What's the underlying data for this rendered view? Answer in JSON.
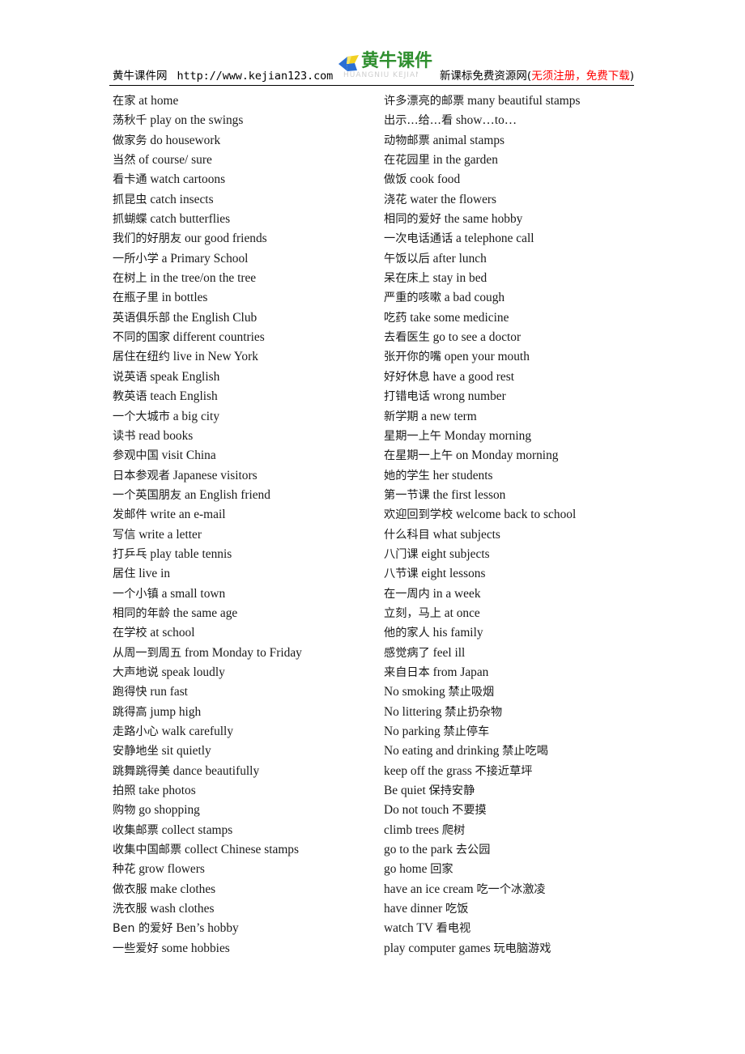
{
  "header": {
    "site_name": "黄牛课件网",
    "site_url": "http://www.kejian123.com",
    "logo_text": "黄牛课件",
    "logo_shadow_text": "HUANGNIU KEJIAN",
    "tagline_black_prefix": "新课标免费资源网(",
    "tagline_red": "无须注册，免费下载",
    "tagline_black_suffix": ")",
    "logo_green": "#2f8f2f",
    "accent_red": "#ff0000"
  },
  "columns": {
    "left": [
      {
        "cn": "在家",
        "en": "at home"
      },
      {
        "cn": "荡秋千",
        "en": " play on the swings"
      },
      {
        "cn": "做家务",
        "en": " do housework"
      },
      {
        "cn": "当然",
        "en": " of course/ sure"
      },
      {
        "cn": "看卡通",
        "en": "watch cartoons"
      },
      {
        "cn": "抓昆虫",
        "en": " catch insects"
      },
      {
        "cn": "抓蝴蝶",
        "en": " catch butterflies"
      },
      {
        "cn": "我们的好朋友",
        "en": "our good friends"
      },
      {
        "cn": "一所小学",
        "en": " a Primary School"
      },
      {
        "cn": "在树上",
        "en": " in the tree/on the tree"
      },
      {
        "cn": "在瓶子里",
        "en": "in bottles"
      },
      {
        "cn": "英语俱乐部",
        "en": "the English Club"
      },
      {
        "cn": "不同的国家",
        "en": "different countries"
      },
      {
        "cn": "居住在纽约",
        "en": " live in New York"
      },
      {
        "cn": "说英语",
        "en": " speak English"
      },
      {
        "cn": "教英语",
        "en": " teach English"
      },
      {
        "cn": "一个大城市",
        "en": " a big city"
      },
      {
        "cn": "读书",
        "en": " read books"
      },
      {
        "cn": "参观中国",
        "en": " visit China"
      },
      {
        "cn": "日本参观者",
        "en": "Japanese visitors"
      },
      {
        "cn": "一个英国朋友",
        "en": "an English friend"
      },
      {
        "cn": "发邮件",
        "en": " write an e-mail"
      },
      {
        "cn": "写信",
        "en": "write a letter"
      },
      {
        "cn": "打乒乓",
        "en": "play table tennis"
      },
      {
        "cn": "居住",
        "en": "live in"
      },
      {
        "cn": "一个小镇",
        "en": " a small town"
      },
      {
        "cn": "相同的年龄",
        "en": " the same age"
      },
      {
        "cn": "在学校",
        "en": " at school"
      },
      {
        "cn": "从周一到周五",
        "en": " from Monday to Friday"
      },
      {
        "cn": "大声地说",
        "en": " speak loudly"
      },
      {
        "cn": "跑得快",
        "en": " run fast"
      },
      {
        "cn": "跳得高",
        "en": " jump high"
      },
      {
        "cn": "走路小心",
        "en": "walk carefully"
      },
      {
        "cn": "安静地坐",
        "en": "sit quietly"
      },
      {
        "cn": "跳舞跳得美",
        "en": "dance beautifully"
      },
      {
        "cn": "拍照",
        "en": " take photos"
      },
      {
        "cn": "购物",
        "en": " go shopping"
      },
      {
        "cn": "收集邮票",
        "en": " collect stamps"
      },
      {
        "cn": "收集中国邮票",
        "en": "collect Chinese stamps"
      },
      {
        "cn": "种花",
        "en": " grow flowers"
      },
      {
        "cn": "做衣服",
        "en": "make clothes"
      },
      {
        "cn": "洗衣服",
        "en": "wash clothes"
      },
      {
        "cn": "Ben 的爱好",
        "en": " Ben’s hobby"
      },
      {
        "cn": "一些爱好",
        "en": " some hobbies"
      }
    ],
    "right": [
      {
        "cn": "许多漂亮的邮票",
        "en": "many beautiful stamps"
      },
      {
        "cn": "出示…给…看",
        "en": "show…to…"
      },
      {
        "cn": "动物邮票",
        "en": " animal stamps"
      },
      {
        "cn": "在花园里",
        "en": " in the  garden"
      },
      {
        "cn": "做饭",
        "en": " cook food"
      },
      {
        "cn": "浇花",
        "en": " water the flowers"
      },
      {
        "cn": "相同的爱好",
        "en": " the same hobby"
      },
      {
        "cn": "一次电话通话",
        "en": "a telephone call"
      },
      {
        "cn": "午饭以后",
        "en": " after lunch"
      },
      {
        "cn": "呆在床上",
        "en": "stay in bed"
      },
      {
        "cn": "严重的咳嗽",
        "en": "a bad cough"
      },
      {
        "cn": "吃药",
        "en": "take some medicine"
      },
      {
        "cn": "去看医生",
        "en": "go to see a doctor"
      },
      {
        "cn": "张开你的嘴",
        "en": "open your mouth"
      },
      {
        "cn": "好好休息",
        "en": "have a good rest"
      },
      {
        "cn": "打错电话",
        "en": " wrong number"
      },
      {
        "cn": "新学期",
        "en": " a new term"
      },
      {
        "cn": "星期一上午",
        "en": "Monday morning"
      },
      {
        "cn": "在星期一上午",
        "en": "on Monday morning"
      },
      {
        "cn": "她的学生",
        "en": " her students"
      },
      {
        "cn": "第一节课",
        "en": "the first lesson"
      },
      {
        "cn": "欢迎回到学校",
        "en": " welcome back to school"
      },
      {
        "cn": "什么科目",
        "en": "what subjects"
      },
      {
        "cn": "八门课",
        "en": "eight subjects"
      },
      {
        "cn": "八节课",
        "en": "eight lessons"
      },
      {
        "cn": "在一周内",
        "en": "in a week"
      },
      {
        "cn": "立刻，马上",
        "en": "at once"
      },
      {
        "cn": "他的家人",
        "en": "his family"
      },
      {
        "cn": "感觉病了",
        "en": "feel ill"
      },
      {
        "cn": "来自日本",
        "en": "from Japan"
      },
      {
        "en": "No smoking",
        "cn": " 禁止吸烟",
        "order": "en-first"
      },
      {
        "en": "No littering",
        "cn": "禁止扔杂物",
        "order": "en-first"
      },
      {
        "en": "No parking",
        "cn": "禁止停车",
        "order": "en-first"
      },
      {
        "en": "No eating and drinking",
        "cn": " 禁止吃喝",
        "order": "en-first"
      },
      {
        "en": "keep off the grass",
        "cn": "不接近草坪",
        "order": "en-first"
      },
      {
        "en": "Be quiet",
        "cn": "保持安静",
        "order": "en-first"
      },
      {
        "en": "Do not touch",
        "cn": "不要摸",
        "order": "en-first"
      },
      {
        "en": "climb trees",
        "cn": "爬树",
        "order": "en-first"
      },
      {
        "en": "go to the park",
        "cn": "去公园",
        "order": "en-first"
      },
      {
        "en": "go home",
        "cn": "回家",
        "order": "en-first"
      },
      {
        "en": "have an ice cream",
        "cn": "吃一个冰激凌",
        "order": "en-first"
      },
      {
        "en": "have dinner",
        "cn": "吃饭",
        "order": "en-first"
      },
      {
        "en": "watch TV",
        "cn": "看电视",
        "order": "en-first"
      },
      {
        "en": "play computer games",
        "cn": " 玩电脑游戏",
        "order": "en-first"
      }
    ]
  }
}
